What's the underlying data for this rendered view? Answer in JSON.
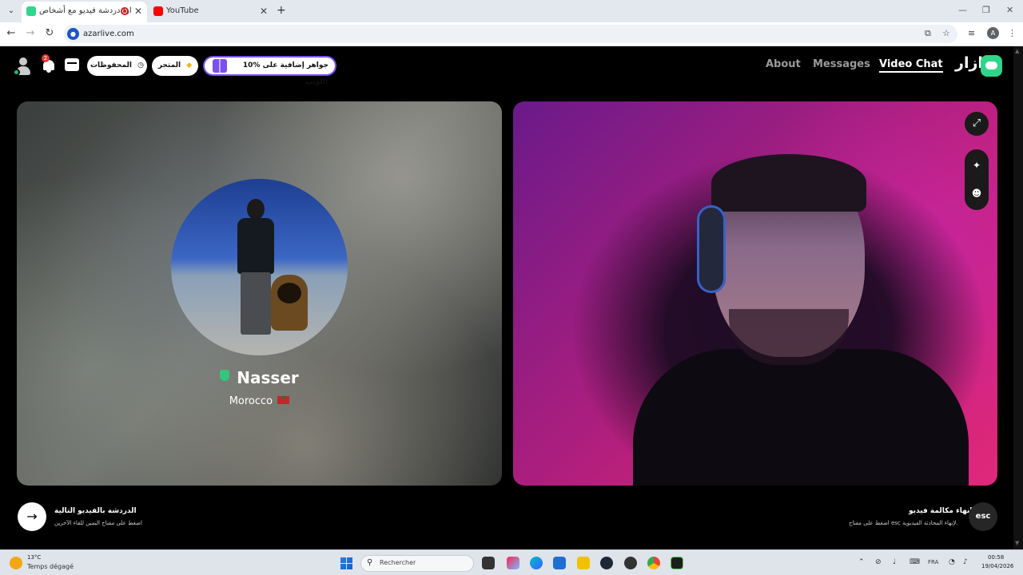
{
  "browser": {
    "tabs": [
      {
        "title": "أزار: دردشة فيديو مع أشخاص",
        "favicon_color": "#2fd68a",
        "recording": true,
        "active": true
      },
      {
        "title": "YouTube",
        "favicon_color": "#ff0000",
        "active": false
      }
    ],
    "url": "azarlive.com",
    "profile_initial": "A"
  },
  "app": {
    "nav": {
      "about": "About",
      "messages": "Messages",
      "video_chat": "Video Chat",
      "logo_text": "ازار"
    },
    "notification_count": "2",
    "saved_label": "المحفوظات",
    "shop_label": "المتجر",
    "promo_label": "10% جواهر إضافية على الويب!"
  },
  "peer": {
    "name": "Nasser",
    "country": "Morocco",
    "verified": true
  },
  "hints": {
    "next_title": "الدردشة بالفيديو التالية",
    "next_sub": "اضغط على مفتاح اليمين للقاء الآخرين",
    "end_title": "إنهاء مكالمة فيديو",
    "end_sub": "اضغط على مفتاح esc لإنهاء المحادثة الفيديوية.",
    "esc_label": "esc"
  },
  "taskbar": {
    "temperature": "13°C",
    "weather": "Temps dégagé",
    "search_placeholder": "Rechercher",
    "language": "FRA",
    "time": "00:58",
    "date": "19/04/2026"
  },
  "colors": {
    "brand": "#2fd68a",
    "promo_border": "#7a4ff5",
    "notification_badge": "#e53935"
  }
}
